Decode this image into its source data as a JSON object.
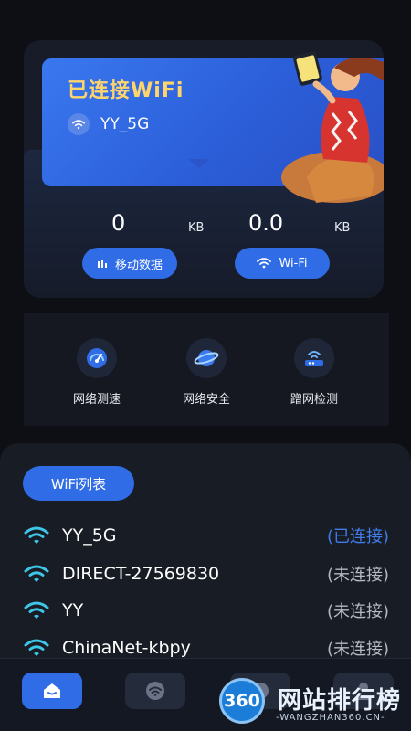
{
  "status": {
    "title": "已连接WiFi",
    "ssid": "YY_5G"
  },
  "stats": {
    "mobile_value": "0",
    "mobile_unit": "KB",
    "wifi_value": "0.0",
    "wifi_unit": "KB",
    "mobile_button": "移动数据",
    "wifi_button": "Wi-Fi"
  },
  "tools": [
    {
      "label": "网络测速",
      "icon": "speedometer-icon"
    },
    {
      "label": "网络安全",
      "icon": "planet-shield-icon"
    },
    {
      "label": "蹭网检测",
      "icon": "router-icon"
    }
  ],
  "wifi_list": {
    "button": "WiFi列表",
    "items": [
      {
        "name": "YY_5G",
        "state": "(已连接)"
      },
      {
        "name": "DIRECT-27569830",
        "state": "(未连接)"
      },
      {
        "name": "YY",
        "state": "(未连接)"
      },
      {
        "name": "ChinaNet-kbpy",
        "state": "(未连接)"
      }
    ]
  },
  "watermark": {
    "badge": "360",
    "title": "网站排行榜",
    "subtitle": "-WANGZHAN360.CN-"
  },
  "colors": {
    "accent": "#2f6ce6",
    "title_yellow": "#ffd56b",
    "connected": "#3f7bea",
    "wifi_icon": "#3ec6e8"
  }
}
